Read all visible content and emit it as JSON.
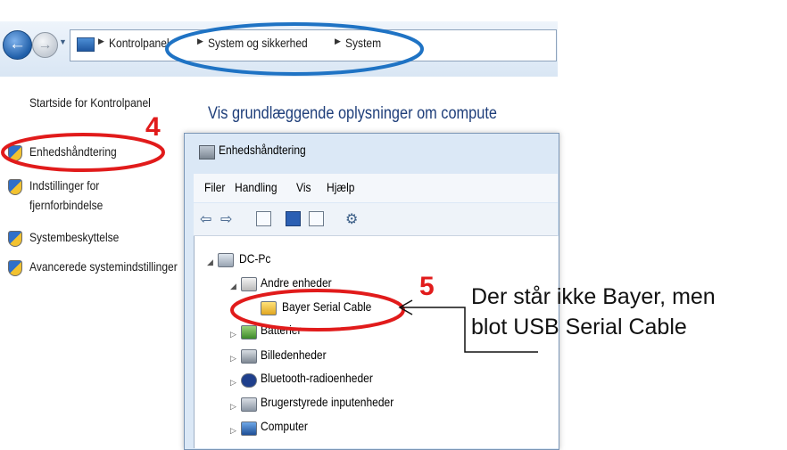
{
  "explorer": {
    "breadcrumbs": [
      "Kontrolpanel",
      "System og sikkerhed",
      "System"
    ],
    "main_header": "Vis grundlæggende oplysninger om compute"
  },
  "left_nav": {
    "home_link": "Startside for Kontrolpanel",
    "items": [
      {
        "label": "Enhedshåndtering"
      },
      {
        "label_line1": "Indstillinger for",
        "label_line2": "fjernforbindelse"
      },
      {
        "label": "Systembeskyttelse"
      },
      {
        "label": "Avancerede systemindstillinger"
      }
    ]
  },
  "device_manager": {
    "title": "Enhedshåndtering",
    "menu": [
      "Filer",
      "Handling",
      "Vis",
      "Hjælp"
    ],
    "tree": {
      "root": "DC-Pc",
      "nodes": [
        "Andre enheder",
        "Bayer Serial Cable",
        "Batterier",
        "Billedenheder",
        "Bluetooth-radioenheder",
        "Brugerstyrede inputenheder",
        "Computer"
      ]
    }
  },
  "annotations": {
    "step4": "4",
    "step5": "5",
    "note_line1": "Der står ikke Bayer, men",
    "note_line2": "blot USB Serial Cable"
  },
  "colors": {
    "highlight_red": "#e11b1b",
    "highlight_blue": "#1f73c4"
  }
}
